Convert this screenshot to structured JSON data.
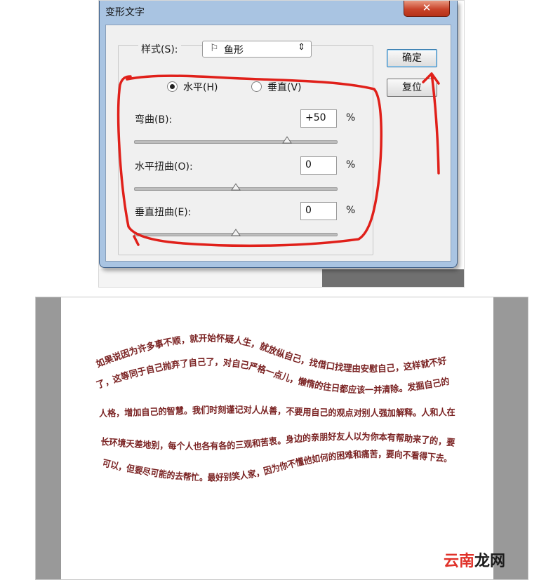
{
  "dialog": {
    "title": "变形文字",
    "close_label": "✕",
    "style": {
      "label": "样式(S):",
      "selected_icon": "flag-icon",
      "selected_value": "鱼形",
      "arrow": "⇕"
    },
    "orientation": {
      "horizontal_label": "水平(H)",
      "vertical_label": "垂直(V)",
      "selected": "horizontal"
    },
    "bend": {
      "label": "弯曲(B):",
      "value": "+50",
      "unit": "%",
      "slider_value": 50
    },
    "h_distortion": {
      "label": "水平扭曲(O):",
      "value": "0",
      "unit": "%",
      "slider_value": 0
    },
    "v_distortion": {
      "label": "垂直扭曲(E):",
      "value": "0",
      "unit": "%",
      "slider_value": 0
    },
    "buttons": {
      "ok": "确定",
      "reset": "复位"
    }
  },
  "preview": {
    "lines": [
      "如果说因为许多事不顺，就开始怀疑人生，就放纵自己，找借口找理由安慰自己，这样就不好",
      "了，这等同于自己抛弃了自己了，对自己严格一点儿，懒惰的往日都应该一并清除。发掘自己的",
      "人格，增加自己的智慧。我们时刻谨记对人从善，不要用自己的观点对别人强加解释。人和人在",
      "长环境天差地别，每个人也各有各的三观和苦衷。身边的亲朋好友人以为你本有帮助来了的，要",
      "可以，但要尽可能的去帮忙。最好别笑人家，因为你不懂他如何的困难和痛苦，要向不看得下去。"
    ],
    "text_color": "#7a2222"
  },
  "watermark": {
    "part1": "云南",
    "part2": "龙网"
  },
  "colors": {
    "annotation": "#e0201a",
    "frame_blue": "#a9c4e2",
    "page_bg": "#999999"
  }
}
